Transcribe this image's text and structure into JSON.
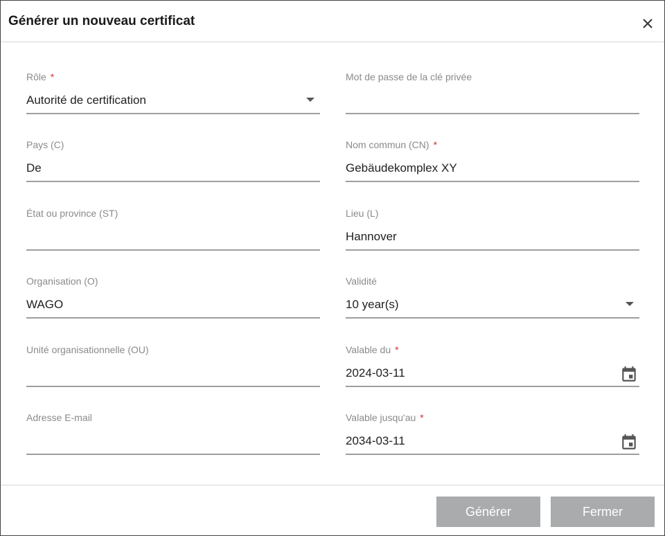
{
  "dialog": {
    "title": "Générer un nouveau certificat"
  },
  "fields": {
    "role": {
      "label": "Rôle",
      "required_mark": "*",
      "value": "Autorité de certification"
    },
    "private_key_password": {
      "label": "Mot de passe de la clé privée",
      "value": ""
    },
    "country": {
      "label": "Pays (C)",
      "value": "De"
    },
    "common_name": {
      "label": "Nom commun (CN)",
      "required_mark": "*",
      "value": "Gebäudekomplex XY"
    },
    "state": {
      "label": "État ou province (ST)",
      "value": ""
    },
    "locality": {
      "label": "Lieu (L)",
      "value": "Hannover"
    },
    "organization": {
      "label": "Organisation (O)",
      "value": "WAGO"
    },
    "validity": {
      "label": "Validité",
      "value": "10 year(s)"
    },
    "org_unit": {
      "label": "Unité organisationnelle (OU)",
      "value": ""
    },
    "valid_from": {
      "label": "Valable du",
      "required_mark": "*",
      "value": "2024-03-11"
    },
    "email": {
      "label": "Adresse E-mail",
      "value": ""
    },
    "valid_until": {
      "label": "Valable jusqu'au",
      "required_mark": "*",
      "value": "2034-03-11"
    }
  },
  "footer": {
    "generate_label": "Générer",
    "close_label": "Fermer"
  },
  "icons": {
    "close": "close-icon",
    "dropdown": "caret-down-icon",
    "calendar": "calendar-icon"
  },
  "colors": {
    "required": "#d32f2f",
    "button_bg": "#a9abad",
    "label": "#8a8a8a"
  }
}
